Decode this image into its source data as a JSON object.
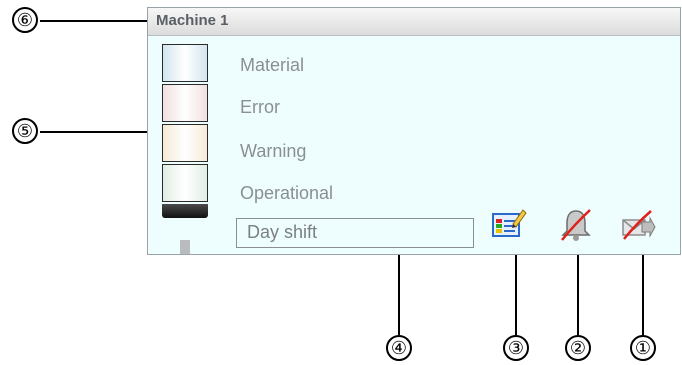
{
  "window": {
    "title": "Machine 1"
  },
  "tower": {
    "lamps": [
      {
        "label": "Material",
        "color": "#d3e6ee"
      },
      {
        "label": "Error",
        "color": "#f1dfdf"
      },
      {
        "label": "Warning",
        "color": "#f5ead6"
      },
      {
        "label": "Operational",
        "color": "#e0ede5"
      }
    ]
  },
  "shift_field": {
    "value": "Day shift"
  },
  "icons": {
    "edit": "notes-edit-icon",
    "alarm_disabled": "bell-muted-icon",
    "forward_disabled": "mail-forward-disabled-icon"
  },
  "callouts": [
    "⑥",
    "⑤",
    "④",
    "③",
    "②",
    "①"
  ]
}
